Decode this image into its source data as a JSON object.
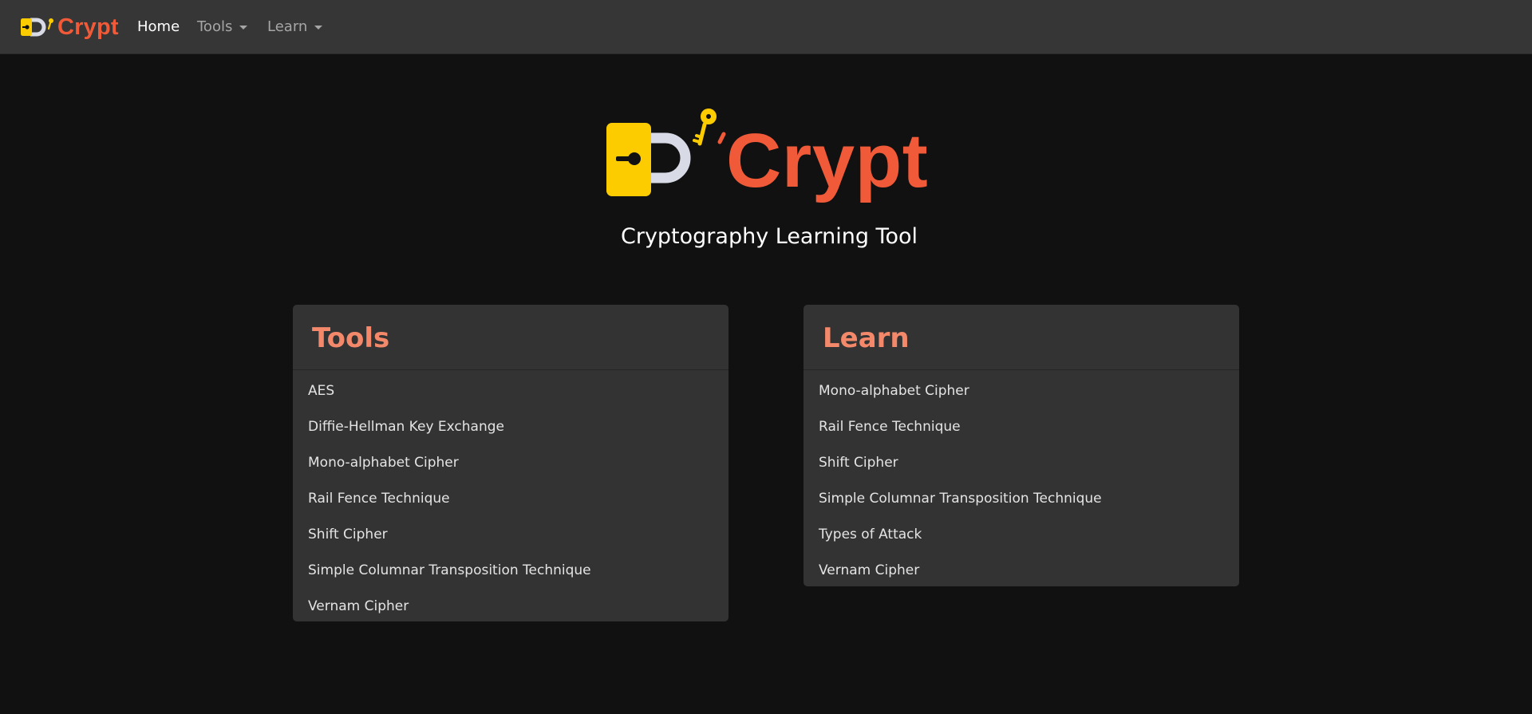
{
  "brand": {
    "name": "Crypt",
    "color": "#f05a38",
    "icon": "padlock-key-icon"
  },
  "nav": {
    "home_label": "Home",
    "tools_label": "Tools",
    "learn_label": "Learn"
  },
  "hero": {
    "title": "Crypt",
    "subtitle": "Cryptography Learning Tool"
  },
  "tools_card": {
    "heading": "Tools",
    "items": [
      "AES",
      "Diffie-Hellman Key Exchange",
      "Mono-alphabet Cipher",
      "Rail Fence Technique",
      "Shift Cipher",
      "Simple Columnar Transposition Technique",
      "Vernam Cipher"
    ]
  },
  "learn_card": {
    "heading": "Learn",
    "items": [
      "Mono-alphabet Cipher",
      "Rail Fence Technique",
      "Shift Cipher",
      "Simple Columnar Transposition Technique",
      "Types of Attack",
      "Vernam Cipher"
    ]
  },
  "colors": {
    "page_background": "#111111",
    "navbar_background": "#363636",
    "card_background": "#333333",
    "card_heading": "#f3896a",
    "lock_body": "#fccc00",
    "lock_shackle": "#d8dbe6"
  }
}
